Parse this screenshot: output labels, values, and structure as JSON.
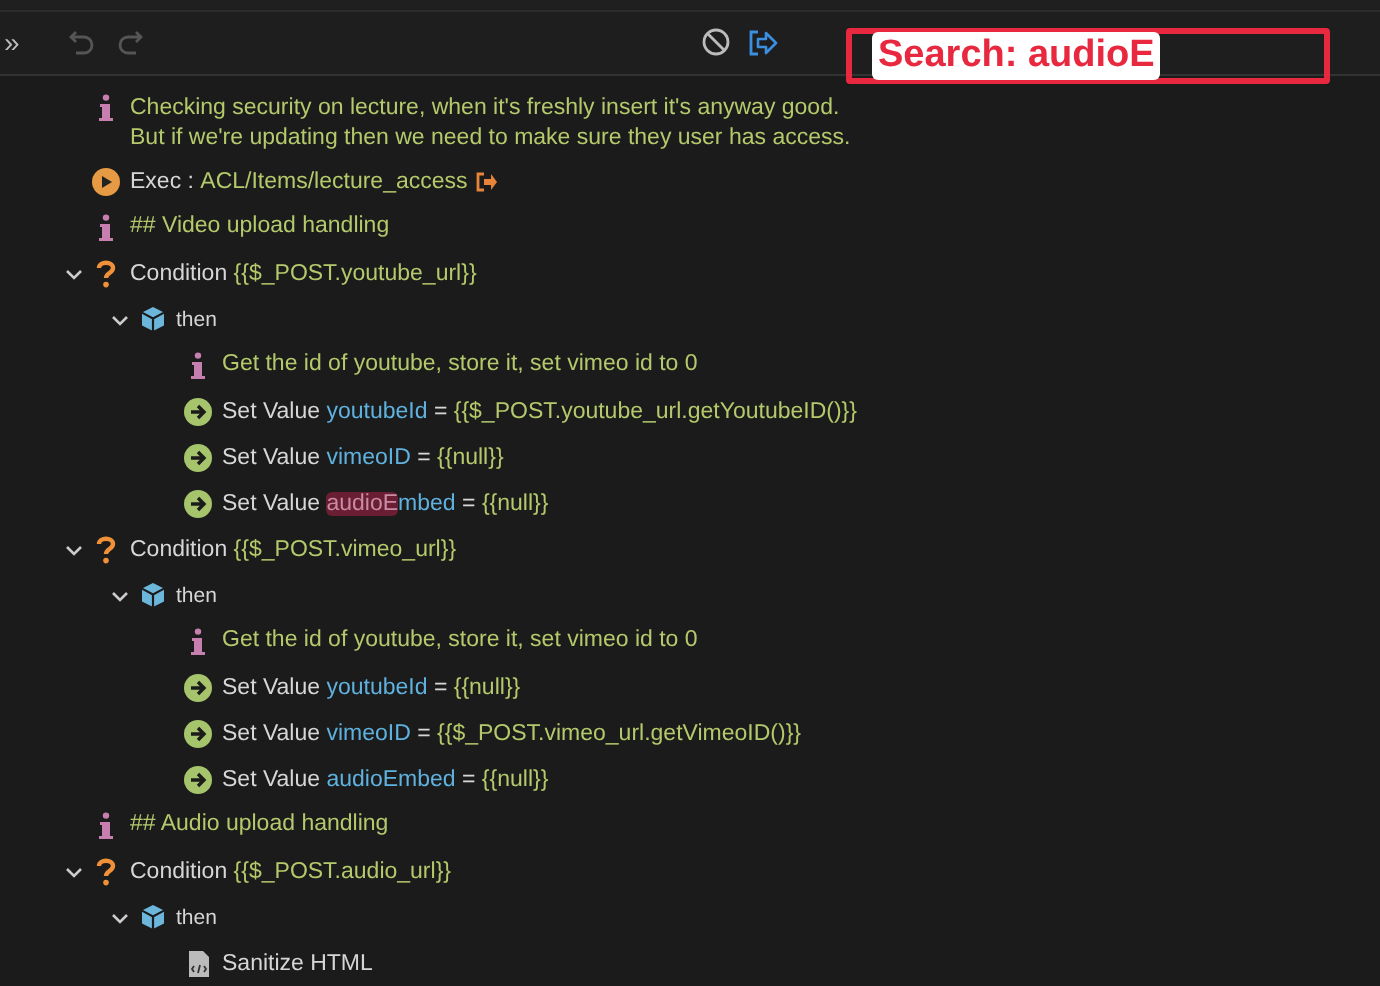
{
  "toolbar": {
    "expand_label": "»"
  },
  "search_overlay": {
    "text": "Search: audioE"
  },
  "steps": [
    {
      "kind": "info",
      "lines": [
        "Checking security on lecture, when it's freshly insert it's anyway good.",
        "But if we're updating then we need to make sure they user has access."
      ]
    },
    {
      "kind": "exec",
      "label": "Exec :",
      "target": "ACL/Items/lecture_access"
    },
    {
      "kind": "info",
      "lines": [
        "## Video upload handling"
      ]
    },
    {
      "kind": "condition",
      "expanded": true,
      "label": "Condition",
      "expression": "{{$_POST.youtube_url}}",
      "children": [
        {
          "kind": "then",
          "expanded": true,
          "label": "then",
          "children": [
            {
              "kind": "info",
              "lines": [
                "Get the id of youtube, store it, set vimeo id to 0"
              ]
            },
            {
              "kind": "setvalue",
              "label": "Set Value",
              "variable": [
                {
                  "text": "youtubeId",
                  "highlighted": false
                }
              ],
              "operator": "=",
              "value": "{{$_POST.youtube_url.getYoutubeID()}}"
            },
            {
              "kind": "setvalue",
              "label": "Set Value",
              "variable": [
                {
                  "text": "vimeoID",
                  "highlighted": false
                }
              ],
              "operator": "=",
              "value": "{{null}}"
            },
            {
              "kind": "setvalue",
              "label": "Set Value",
              "variable": [
                {
                  "text": "audioE",
                  "highlighted": true
                },
                {
                  "text": "mbed",
                  "highlighted": false
                }
              ],
              "operator": "=",
              "value": "{{null}}"
            }
          ]
        }
      ]
    },
    {
      "kind": "condition",
      "expanded": true,
      "label": "Condition",
      "expression": "{{$_POST.vimeo_url}}",
      "children": [
        {
          "kind": "then",
          "expanded": true,
          "label": "then",
          "children": [
            {
              "kind": "info",
              "lines": [
                "Get the id of youtube, store it, set vimeo id to 0"
              ]
            },
            {
              "kind": "setvalue",
              "label": "Set Value",
              "variable": [
                {
                  "text": "youtubeId",
                  "highlighted": false
                }
              ],
              "operator": "=",
              "value": "{{null}}"
            },
            {
              "kind": "setvalue",
              "label": "Set Value",
              "variable": [
                {
                  "text": "vimeoID",
                  "highlighted": false
                }
              ],
              "operator": "=",
              "value": "{{$_POST.vimeo_url.getVimeoID()}}"
            },
            {
              "kind": "setvalue",
              "label": "Set Value",
              "variable": [
                {
                  "text": "audioEmbed",
                  "highlighted": false
                }
              ],
              "operator": "=",
              "value": "{{null}}"
            }
          ]
        }
      ]
    },
    {
      "kind": "info",
      "lines": [
        "## Audio upload handling"
      ]
    },
    {
      "kind": "condition",
      "expanded": true,
      "label": "Condition",
      "expression": "{{$_POST.audio_url}}",
      "children": [
        {
          "kind": "then",
          "expanded": true,
          "label": "then",
          "children": [
            {
              "kind": "sanitize",
              "label": "Sanitize HTML"
            }
          ]
        }
      ]
    }
  ]
}
